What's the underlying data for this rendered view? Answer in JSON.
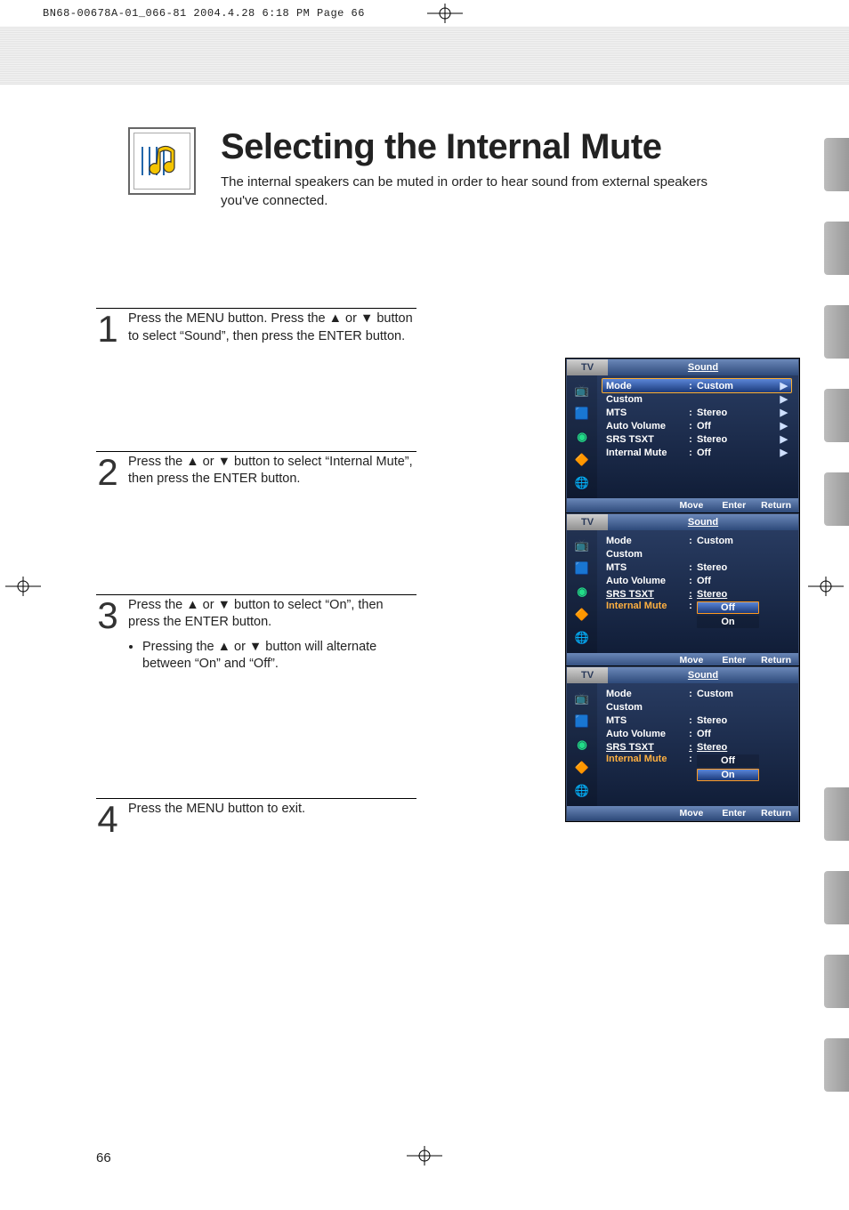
{
  "print_header": "BN68-00678A-01_066-81  2004.4.28  6:18 PM  Page 66",
  "title": "Selecting the Internal Mute",
  "subtitle": "The internal speakers can be muted in order to hear sound from external speakers you've connected.",
  "steps": {
    "s1": {
      "num": "1",
      "text": "Press the MENU button. Press the ▲ or ▼ button to select “Sound”, then press the ENTER button."
    },
    "s2": {
      "num": "2",
      "text": "Press the ▲ or ▼ button to select “Internal Mute”, then press the ENTER button."
    },
    "s3": {
      "num": "3",
      "text": "Press the ▲ or ▼ button to select “On”, then press the ENTER button.",
      "bullet": "Pressing the ▲ or ▼ button will alternate between “On” and “Off”."
    },
    "s4": {
      "num": "4",
      "text": "Press the MENU button to exit."
    }
  },
  "osd_common": {
    "tv": "TV",
    "header": "Sound",
    "footer_move": "Move",
    "footer_enter": "Enter",
    "footer_return": "Return"
  },
  "osd_labels": {
    "mode": "Mode",
    "custom": "Custom",
    "mts": "MTS",
    "auto_volume": "Auto Volume",
    "srs": "SRS TSXT",
    "internal_mute": "Internal Mute"
  },
  "osd_values": {
    "mode": "Custom",
    "mts": "Stereo",
    "auto_volume": "Off",
    "srs": "Stereo",
    "internal_mute": "Off",
    "opt_off": "Off",
    "opt_on": "On"
  },
  "page_number": "66"
}
